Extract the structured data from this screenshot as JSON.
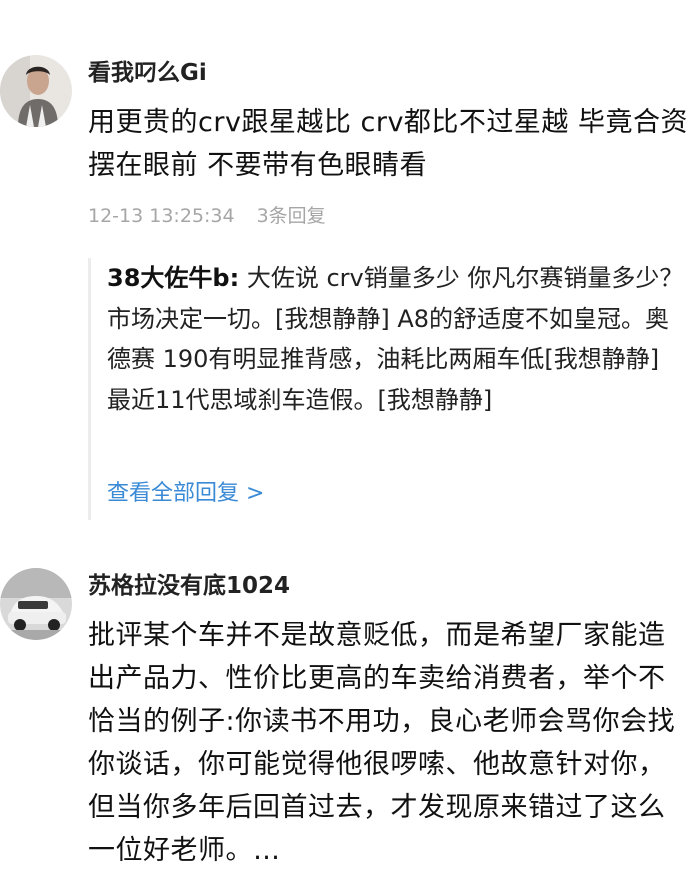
{
  "comments": [
    {
      "username": "看我叼么Gi",
      "content": "用更贵的crv跟星越比 crv都比不过星越 毕竟合资摆在眼前 不要带有色眼睛看",
      "time": "12-13 13:25:34",
      "reply_count": "3条回复",
      "reply": {
        "author": "38大佐牛b:",
        "text": "大佐说 crv销量多少 你凡尔赛销量多少？市场决定一切。[我想静静] A8的舒适度不如皇冠。奥德赛 190有明显推背感，油耗比两厢车低[我想静静] 最近11代思域刹车造假。[我想静静]"
      },
      "view_all": "查看全部回复 >"
    },
    {
      "username": "苏格拉没有底1024",
      "content": "批评某个车并不是故意贬低，而是希望厂家能造出产品力、性价比更高的车卖给消费者，举个不恰当的例子:你读书不用功，良心老师会骂你会找你谈话，你可能觉得他很啰嗦、他故意针对你，但当你多年后回首过去，才发现原来错过了这么一位好老师。…"
    }
  ]
}
